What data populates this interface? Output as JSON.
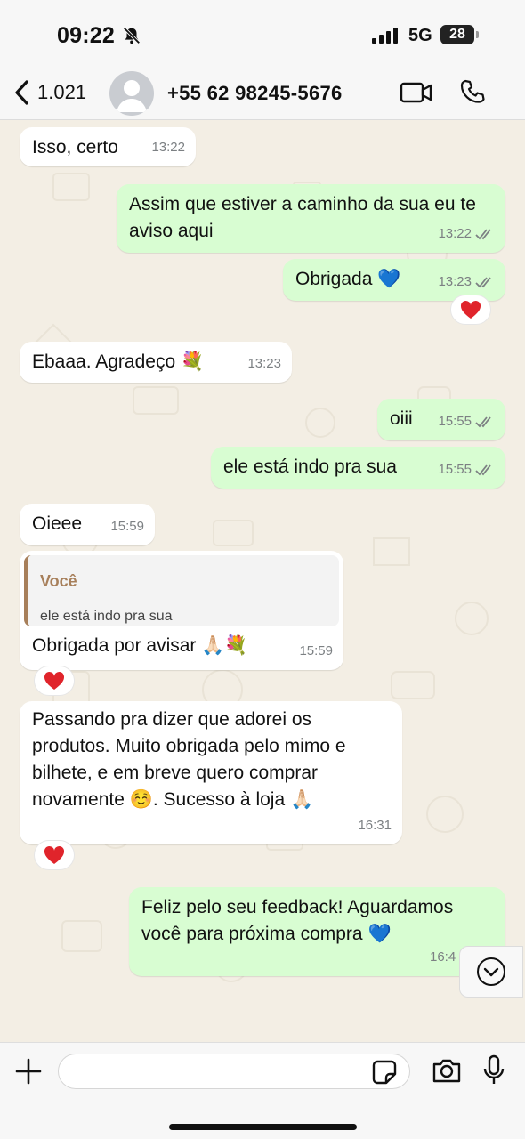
{
  "status": {
    "time": "09:22",
    "network": "5G",
    "battery": "28"
  },
  "header": {
    "back_count": "1.021",
    "contact": "+55 62 98245-5676"
  },
  "messages": [
    {
      "text": "Isso, certo",
      "time": "13:22"
    },
    {
      "text": "Assim que estiver a caminho da sua eu te aviso aqui",
      "time": "13:22"
    },
    {
      "text": "Obrigada 💙",
      "time": "13:23",
      "reaction": "❤"
    },
    {
      "text": "Ebaaa. Agradeço 💐",
      "time": "13:23"
    },
    {
      "text": "oiii",
      "time": "15:55"
    },
    {
      "text": "ele está indo pra sua",
      "time": "15:55"
    },
    {
      "text": "Oieee",
      "time": "15:59"
    },
    {
      "quote_author": "Você",
      "quote_text": "ele está indo pra sua",
      "text": "Obrigada por avisar 🙏🏻💐",
      "time": "15:59",
      "reaction": "❤"
    },
    {
      "text": "Passando pra dizer que adorei os produtos. Muito obrigada pelo mimo e bilhete, e em breve quero comprar novamente ☺️. Sucesso à loja 🙏🏻",
      "time": "16:31",
      "reaction": "❤"
    },
    {
      "text": "Feliz pelo seu feedback! Aguardamos você para próxima  compra  💙",
      "time": "16:4"
    }
  ],
  "colors": {
    "outgoing": "#d8fdd2",
    "incoming": "#ffffff",
    "background": "#f3eee4",
    "quote_accent": "#a77f5a"
  },
  "input": {
    "placeholder": ""
  }
}
